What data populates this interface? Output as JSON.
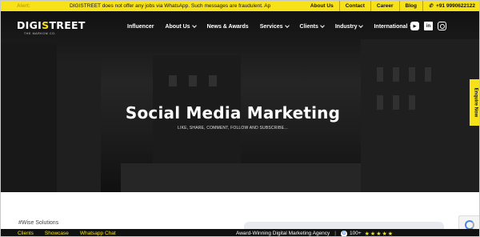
{
  "alert": {
    "label": "Alert:",
    "message": "DIGISTREET does not offer any jobs via WhatsApp. Such messages are fraudulent. Ap",
    "links": [
      "About Us",
      "Contact",
      "Career",
      "Blog"
    ],
    "phone": "+91 9990622122"
  },
  "logo": {
    "brand_pre": "DIGI",
    "brand_accent": "S",
    "brand_post": "TREET",
    "tagline": "THE MARKOM CO."
  },
  "nav": {
    "items": [
      {
        "label": "Influencer",
        "dropdown": false
      },
      {
        "label": "About Us",
        "dropdown": true
      },
      {
        "label": "News & Awards",
        "dropdown": false
      },
      {
        "label": "Services",
        "dropdown": true
      },
      {
        "label": "Clients",
        "dropdown": true
      },
      {
        "label": "Industry",
        "dropdown": true
      },
      {
        "label": "International",
        "dropdown": true
      }
    ],
    "socials": [
      "youtube-icon",
      "linkedin-icon",
      "instagram-icon"
    ]
  },
  "hero": {
    "title": "Social Media Marketing",
    "subtitle": "LIKE, SHARE, COMMENT, FOLLOW AND SUBSCRIBE..."
  },
  "enquire": {
    "label": "Enquire Now"
  },
  "section": {
    "label": "#Wise Solutions"
  },
  "bottom_bar": {
    "links": [
      "Clients",
      "Showcase",
      "Whatsapp Chat"
    ],
    "tagline": "Award-Winning Digital Marketing Agency",
    "separator": "|",
    "rating": "100+",
    "stars": "★★★★★"
  },
  "colors": {
    "accent": "#f7e21a",
    "dark": "#111111"
  }
}
